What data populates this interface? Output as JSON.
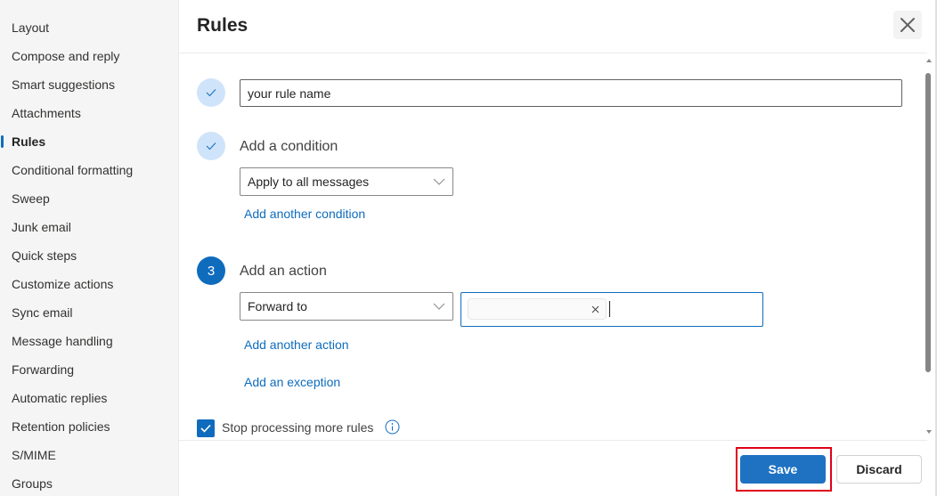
{
  "sidebar": {
    "items": [
      {
        "label": "Layout",
        "active": false
      },
      {
        "label": "Compose and reply",
        "active": false
      },
      {
        "label": "Smart suggestions",
        "active": false
      },
      {
        "label": "Attachments",
        "active": false
      },
      {
        "label": "Rules",
        "active": true
      },
      {
        "label": "Conditional formatting",
        "active": false
      },
      {
        "label": "Sweep",
        "active": false
      },
      {
        "label": "Junk email",
        "active": false
      },
      {
        "label": "Quick steps",
        "active": false
      },
      {
        "label": "Customize actions",
        "active": false
      },
      {
        "label": "Sync email",
        "active": false
      },
      {
        "label": "Message handling",
        "active": false
      },
      {
        "label": "Forwarding",
        "active": false
      },
      {
        "label": "Automatic replies",
        "active": false
      },
      {
        "label": "Retention policies",
        "active": false
      },
      {
        "label": "S/MIME",
        "active": false
      },
      {
        "label": "Groups",
        "active": false
      }
    ]
  },
  "panel": {
    "title": "Rules",
    "close_icon": "close-icon"
  },
  "steps": {
    "name": {
      "status": "complete",
      "icon": "checkmark-icon",
      "value": "your rule name"
    },
    "condition": {
      "status": "complete",
      "icon": "checkmark-icon",
      "label": "Add a condition",
      "selected": "Apply to all messages",
      "add_link": "Add another condition"
    },
    "action": {
      "status": "current",
      "number": "3",
      "label": "Add an action",
      "selected": "Forward to",
      "recipient_chip": "",
      "add_link": "Add another action",
      "exception_link": "Add an exception"
    }
  },
  "options": {
    "stop_processing_label": "Stop processing more rules",
    "stop_processing_checked": true,
    "info_icon": "info-icon"
  },
  "footer": {
    "save_label": "Save",
    "discard_label": "Discard"
  },
  "colors": {
    "accent": "#0f6cbd",
    "save_button": "#1f72c2",
    "highlight_box": "#e0001b",
    "step_done_bg": "#cfe4fa"
  }
}
